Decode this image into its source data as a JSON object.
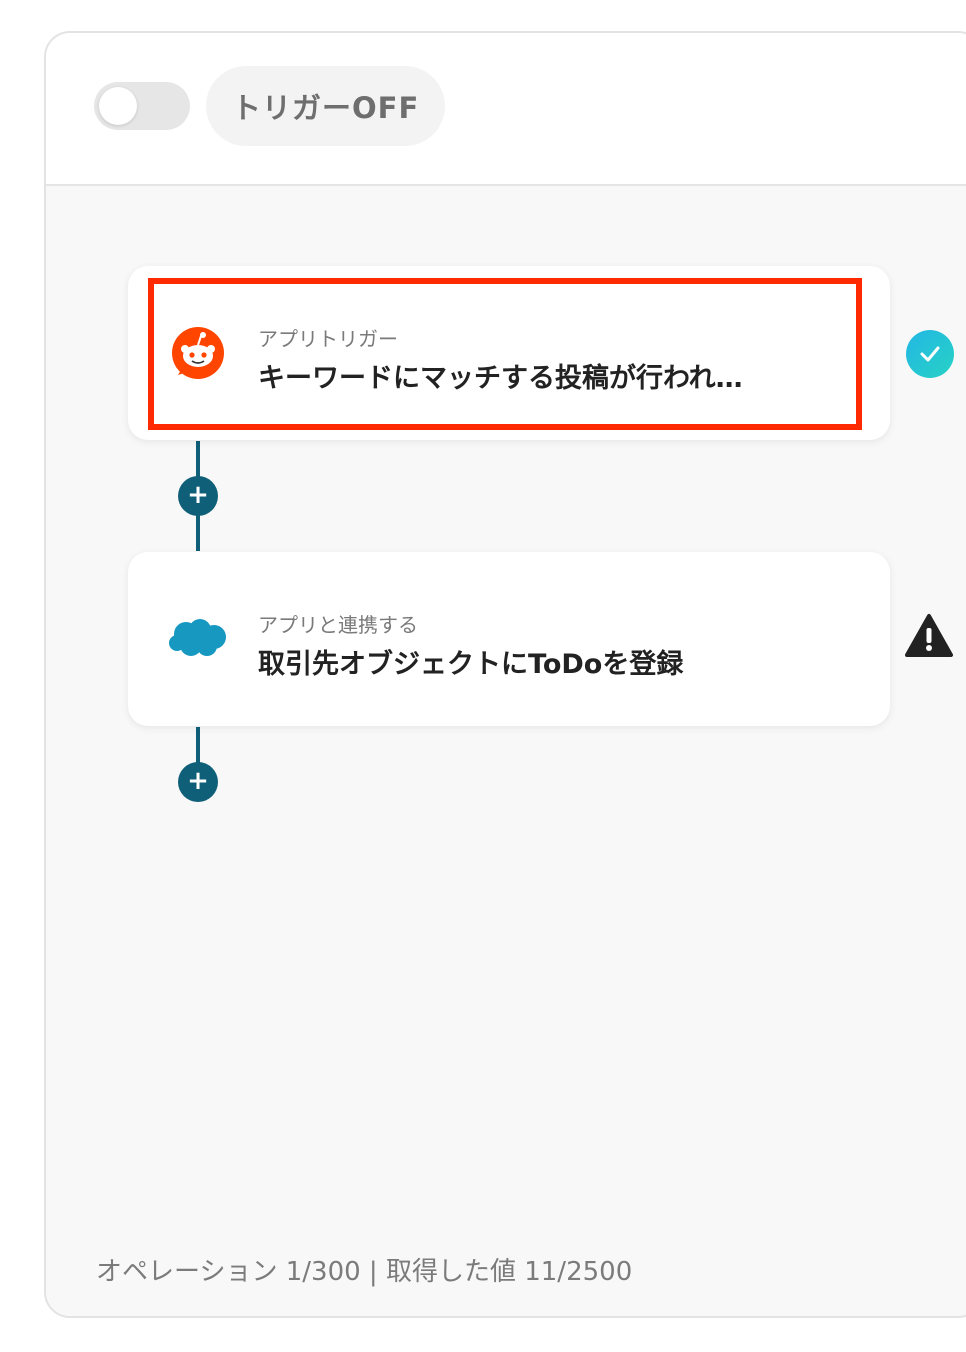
{
  "header": {
    "toggle_state": "off",
    "trigger_label": "トリガーOFF"
  },
  "flow": {
    "steps": [
      {
        "app_icon": "reddit-icon",
        "subtitle": "アプリトリガー",
        "title": "キーワードにマッチする投稿が行われ…",
        "status": "check-icon",
        "highlighted": true
      },
      {
        "app_icon": "salesforce-cloud-icon",
        "subtitle": "アプリと連携する",
        "title": "取引先オブジェクトにToDoを登録",
        "status": "warning-icon",
        "highlighted": false
      }
    ],
    "add_step_symbol": "+"
  },
  "footer": {
    "usage_text": "オペレーション 1/300 | 取得した値 11/2500"
  },
  "colors": {
    "accent": "#0f5f79",
    "highlight": "#ff2a00",
    "reddit": "#ff4500",
    "salesforce": "#1798c1",
    "check_gradient_start": "#23b7e5",
    "check_gradient_end": "#27d2c4"
  }
}
